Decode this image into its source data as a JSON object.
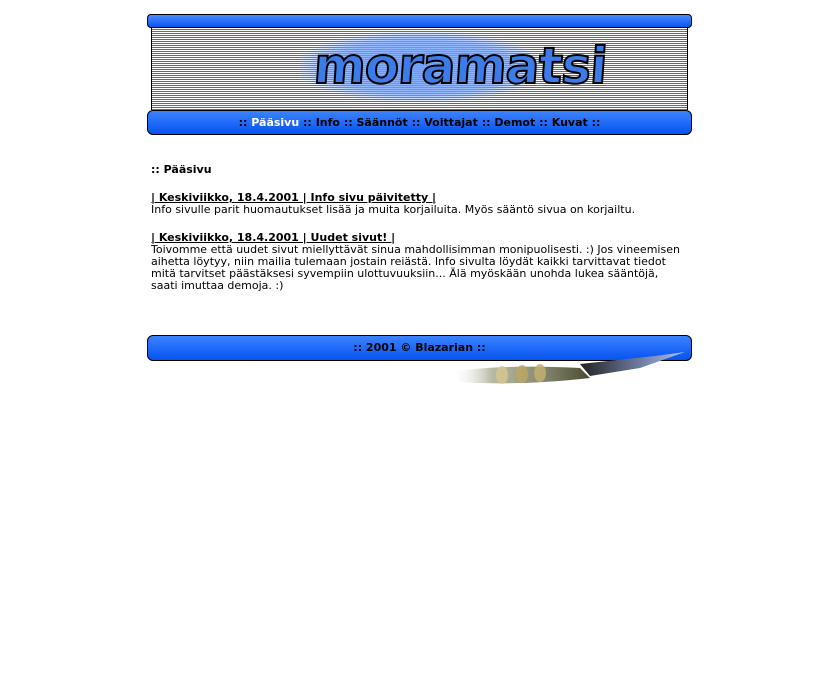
{
  "banner": {
    "logo_text": "moramatsi"
  },
  "nav": {
    "prefix": "::",
    "items": [
      {
        "label": "Pääsivu",
        "active": true
      },
      {
        "label": "Info"
      },
      {
        "label": "Säännöt"
      },
      {
        "label": "Voittajat"
      },
      {
        "label": "Demot"
      },
      {
        "label": "Kuvat"
      }
    ],
    "separator": "::"
  },
  "main": {
    "section_title": ":: Pääsivu",
    "news": [
      {
        "heading": "| Keskiviikko, 18.4.2001 | Info sivu päivitetty |",
        "body": "Info sivulle parit huomautukset lisää ja muita korjailuita. Myös sääntö sivua on korjailtu."
      },
      {
        "heading": "| Keskiviikko, 18.4.2001 | Uudet sivut! |",
        "body": "Toivomme että uudet sivut miellyttävät sinua mahdollisimman monipuolisesti. :) Jos vineemisen aihetta löytyy, niin mailia tulemaan jostain reiästä. Info sivulta löydät kaikki tarvittavat tiedot mitä tarvitset päästäksesi syvempiin ulottuvuuksiin... Älä myöskään unohda lukea sääntöjä, saati imuttaa demoja. :)"
      }
    ]
  },
  "footer": {
    "text": ":: 2001 © Blazarian ::"
  },
  "colors": {
    "bar_blue": "#0a55f0",
    "stripe_blue": "#3a6fd6"
  }
}
